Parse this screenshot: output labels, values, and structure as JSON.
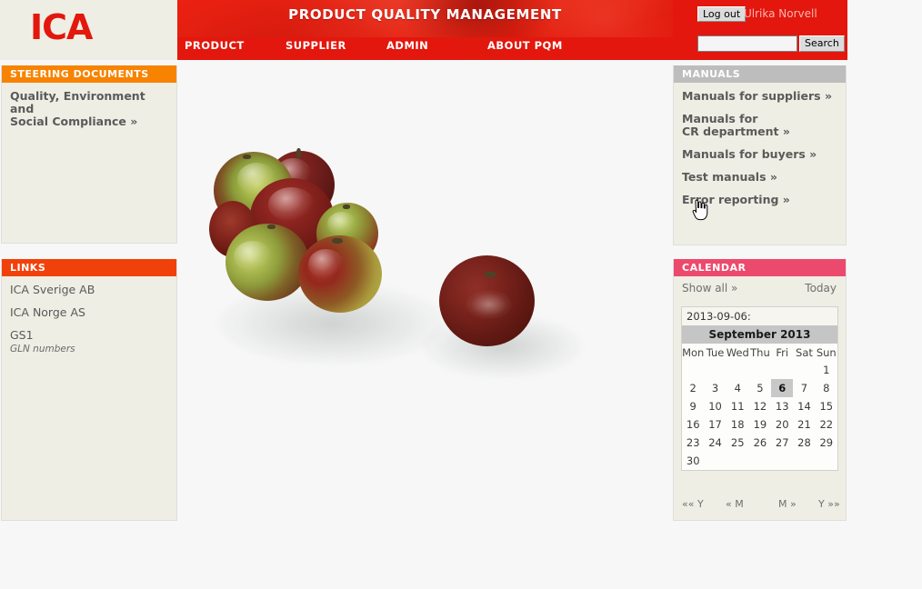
{
  "brand": {
    "logo_text": "ICA",
    "logo_color": "#e3170d"
  },
  "header": {
    "title": "PRODUCT QUALITY MANAGEMENT",
    "nav": [
      {
        "label": "PRODUCT"
      },
      {
        "label": "SUPPLIER"
      },
      {
        "label": "ADMIN"
      },
      {
        "label": "ABOUT PQM"
      }
    ]
  },
  "account": {
    "logout_label": "Log out",
    "user_name": "Ulrika Norvell",
    "search_value": "",
    "search_placeholder": "",
    "search_button": "Search"
  },
  "steering": {
    "heading": "STEERING DOCUMENTS",
    "heading_color": "#f78300",
    "links": [
      {
        "label": "Quality, Environment and Social Compliance »"
      }
    ]
  },
  "links_panel": {
    "heading": "LINKS",
    "heading_color": "#f1410a",
    "links": [
      {
        "label": "ICA Sverige AB",
        "sub": ""
      },
      {
        "label": "ICA Norge AS",
        "sub": ""
      },
      {
        "label": "GS1",
        "sub": "GLN numbers"
      }
    ]
  },
  "manuals": {
    "heading": "MANUALS",
    "heading_color": "#bdbdbd",
    "links": [
      {
        "label": "Manuals for suppliers »"
      },
      {
        "label": "Manuals for CR department »"
      },
      {
        "label": "Manuals for buyers »"
      },
      {
        "label": "Test manuals »"
      },
      {
        "label": "Error reporting »"
      }
    ]
  },
  "calendar": {
    "heading": "CALENDAR",
    "heading_color": "#ec4a6d",
    "show_all_label": "Show all »",
    "today_label": "Today",
    "selected_date": "2013-09-06:",
    "month_title": "September 2013",
    "weekdays": [
      "Mon",
      "Tue",
      "Wed",
      "Thu",
      "Fri",
      "Sat",
      "Sun"
    ],
    "weeks": [
      [
        "",
        "",
        "",
        "",
        "",
        "",
        "1"
      ],
      [
        "2",
        "3",
        "4",
        "5",
        "6",
        "7",
        "8"
      ],
      [
        "9",
        "10",
        "11",
        "12",
        "13",
        "14",
        "15"
      ],
      [
        "16",
        "17",
        "18",
        "19",
        "20",
        "21",
        "22"
      ],
      [
        "23",
        "24",
        "25",
        "26",
        "27",
        "28",
        "29"
      ],
      [
        "30",
        "",
        "",
        "",
        "",
        "",
        ""
      ]
    ],
    "today_day": "6",
    "nav": [
      {
        "label": "«« Y"
      },
      {
        "label": "« M"
      },
      {
        "label": "M »"
      },
      {
        "label": "Y »»"
      }
    ]
  },
  "main": {
    "image_alt": "apples-photograph"
  },
  "cursor": {
    "type": "hand-pointer"
  }
}
